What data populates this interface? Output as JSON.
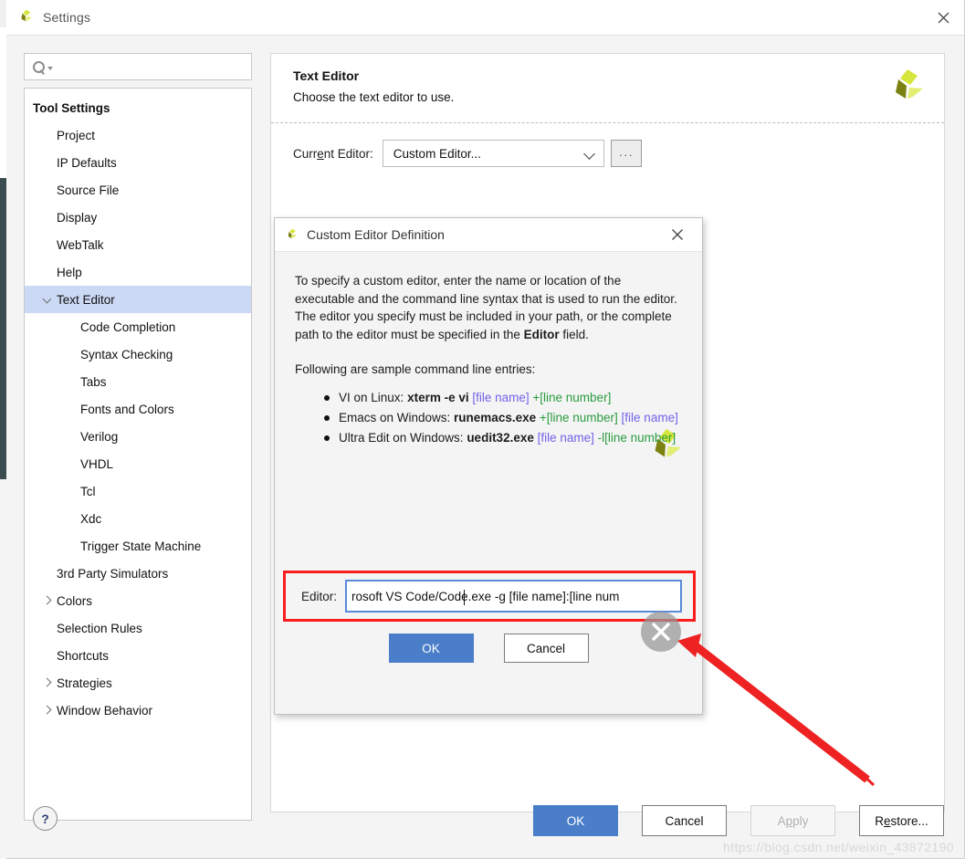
{
  "window": {
    "title": "Settings",
    "close_icon": "close-icon",
    "logo_icon": "xilinx-logo-icon"
  },
  "search": {
    "icon": "search-icon",
    "dropdown_icon": "chevron-down-icon",
    "value": "",
    "placeholder": ""
  },
  "tree": {
    "items": [
      {
        "label": "Tool Settings",
        "indent": 0,
        "bold": true,
        "twisty": "none",
        "selected": false
      },
      {
        "label": "Project",
        "indent": 1,
        "bold": false,
        "twisty": "none",
        "selected": false
      },
      {
        "label": "IP Defaults",
        "indent": 1,
        "bold": false,
        "twisty": "none",
        "selected": false
      },
      {
        "label": "Source File",
        "indent": 1,
        "bold": false,
        "twisty": "none",
        "selected": false
      },
      {
        "label": "Display",
        "indent": 1,
        "bold": false,
        "twisty": "none",
        "selected": false
      },
      {
        "label": "WebTalk",
        "indent": 1,
        "bold": false,
        "twisty": "none",
        "selected": false
      },
      {
        "label": "Help",
        "indent": 1,
        "bold": false,
        "twisty": "none",
        "selected": false
      },
      {
        "label": "Text Editor",
        "indent": 1,
        "bold": false,
        "twisty": "open",
        "selected": true
      },
      {
        "label": "Code Completion",
        "indent": 2,
        "bold": false,
        "twisty": "none",
        "selected": false
      },
      {
        "label": "Syntax Checking",
        "indent": 2,
        "bold": false,
        "twisty": "none",
        "selected": false
      },
      {
        "label": "Tabs",
        "indent": 2,
        "bold": false,
        "twisty": "none",
        "selected": false
      },
      {
        "label": "Fonts and Colors",
        "indent": 2,
        "bold": false,
        "twisty": "none",
        "selected": false
      },
      {
        "label": "Verilog",
        "indent": 2,
        "bold": false,
        "twisty": "none",
        "selected": false
      },
      {
        "label": "VHDL",
        "indent": 2,
        "bold": false,
        "twisty": "none",
        "selected": false
      },
      {
        "label": "Tcl",
        "indent": 2,
        "bold": false,
        "twisty": "none",
        "selected": false
      },
      {
        "label": "Xdc",
        "indent": 2,
        "bold": false,
        "twisty": "none",
        "selected": false
      },
      {
        "label": "Trigger State Machine",
        "indent": 2,
        "bold": false,
        "twisty": "none",
        "selected": false
      },
      {
        "label": "3rd Party Simulators",
        "indent": 1,
        "bold": false,
        "twisty": "none",
        "selected": false
      },
      {
        "label": "Colors",
        "indent": 1,
        "bold": false,
        "twisty": "closed",
        "selected": false
      },
      {
        "label": "Selection Rules",
        "indent": 1,
        "bold": false,
        "twisty": "none",
        "selected": false
      },
      {
        "label": "Shortcuts",
        "indent": 1,
        "bold": false,
        "twisty": "none",
        "selected": false
      },
      {
        "label": "Strategies",
        "indent": 1,
        "bold": false,
        "twisty": "closed",
        "selected": false
      },
      {
        "label": "Window Behavior",
        "indent": 1,
        "bold": false,
        "twisty": "closed",
        "selected": false
      }
    ]
  },
  "panel": {
    "title": "Text Editor",
    "subtitle": "Choose the text editor to use.",
    "logo_icon": "xilinx-logo-icon",
    "current_editor_label_pre": "Curr",
    "current_editor_label_mnemonic": "e",
    "current_editor_label_post": "nt Editor:",
    "current_editor_value": "Custom Editor...",
    "dropdown_icon": "chevron-down-icon",
    "ellipsis_button_label": "···"
  },
  "footer": {
    "help_label": "?",
    "ok_label": "OK",
    "cancel_label": "Cancel",
    "apply_label_pre": "A",
    "apply_label_mnemonic": "p",
    "apply_label_post": "ply",
    "apply_disabled": true,
    "restore_label_pre": "R",
    "restore_label_mnemonic": "e",
    "restore_label_post": "store..."
  },
  "dialog": {
    "title": "Custom Editor Definition",
    "logo_icon": "xilinx-logo-icon",
    "close_icon": "close-icon",
    "body_logo_icon": "xilinx-logo-icon",
    "paragraph1": "To specify a custom editor, enter the name or location of the executable and the command line syntax that is used to run the editor.",
    "paragraph2_a": "The editor you specify must be included in your path, or the complete path to the editor must be specified in the ",
    "paragraph2_bold": "Editor",
    "paragraph2_b": " field.",
    "samples_heading": "Following are sample command line entries:",
    "samples": [
      {
        "prefix": "VI on Linux: ",
        "cmd": "xterm -e vi",
        "file": " [file name]",
        "line": " +[line number]"
      },
      {
        "prefix": "Emacs on Windows: ",
        "cmd": "runemacs.exe",
        "line": " +[line number]",
        "file": " [file name]"
      },
      {
        "prefix": "Ultra Edit on Windows: ",
        "cmd": "uedit32.exe",
        "file": " [file name]",
        "line": " -l[line number]"
      }
    ],
    "editor_field_label": "Editor:",
    "editor_field_value": "rosoft VS Code/Code.exe -g [file name]:[line num",
    "ok_label": "OK",
    "cancel_label": "Cancel"
  },
  "annotation": {
    "highlight_color": "#fb1d1d",
    "arrow_color": "#ee2222",
    "cursor_icon": "clear-circle-x-icon"
  },
  "watermark": {
    "text": "https://blog.csdn.net/weixin_43872190"
  },
  "colors": {
    "accent_blue": "#4a7ec9",
    "selection_blue": "#ccd9f5",
    "file_token": "#6f63e8",
    "line_token": "#2a9c3f",
    "logo_light": "#d4e157",
    "logo_dark": "#7c8211"
  }
}
